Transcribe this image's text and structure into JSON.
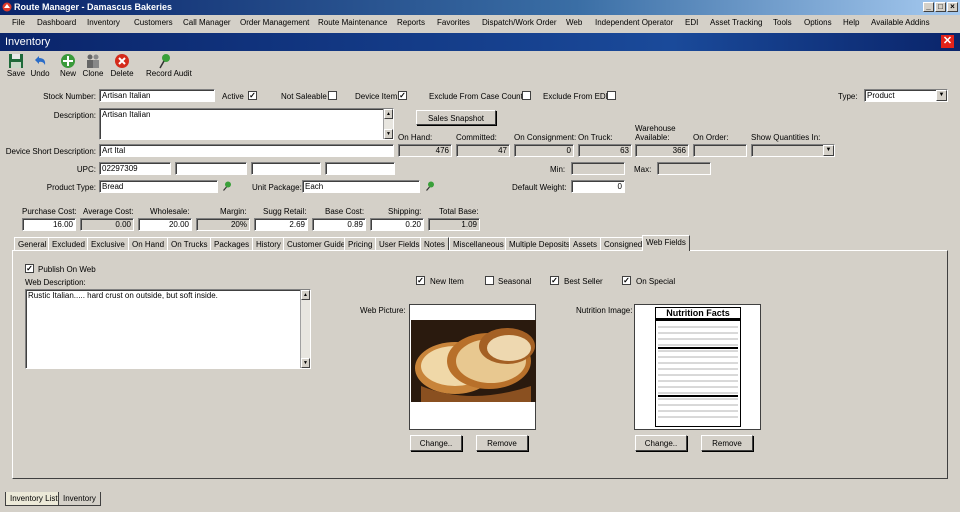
{
  "window": {
    "title": "Route Manager - Damascus Bakeries"
  },
  "menu": [
    "File",
    "Dashboard",
    "Inventory",
    "Customers",
    "Call Manager",
    "Order Management",
    "Route Maintenance",
    "Reports",
    "Favorites",
    "Dispatch/Work Order",
    "Web",
    "Independent Operator",
    "EDI",
    "Asset Tracking",
    "Tools",
    "Options",
    "Help",
    "Available Addins"
  ],
  "form_title": "Inventory",
  "toolbar": {
    "save": "Save",
    "undo": "Undo",
    "new": "New",
    "clone": "Clone",
    "delete": "Delete",
    "record_audit": "Record Audit"
  },
  "fields": {
    "stock_number_label": "Stock Number:",
    "stock_number": "Artisan Italian",
    "active_label": "Active",
    "not_saleable_label": "Not Saleable",
    "device_item_label": "Device Item",
    "exclude_case_counts_label": "Exclude From Case Counts",
    "exclude_edi_label": "Exclude From EDI",
    "type_label": "Type:",
    "type_value": "Product",
    "description_label": "Description:",
    "description": "Artisan Italian",
    "sales_snapshot": "Sales Snapshot",
    "device_short_desc_label": "Device Short Description:",
    "device_short_desc": "Art Ital",
    "upc_label": "UPC:",
    "upc": "02297309",
    "product_type_label": "Product Type:",
    "product_type": "Bread",
    "unit_package_label": "Unit Package:",
    "unit_package": "Each",
    "on_hand_label": "On Hand:",
    "on_hand": "476",
    "committed_label": "Committed:",
    "committed": "47",
    "on_consignment_label": "On Consignment:",
    "on_consignment": "0",
    "on_truck_label": "On Truck:",
    "on_truck": "63",
    "warehouse_available_label": "Warehouse Available:",
    "warehouse_available": "366",
    "on_order_label": "On Order:",
    "show_quantities_label": "Show Quantities In:",
    "min_label": "Min:",
    "max_label": "Max:",
    "default_weight_label": "Default Weight:",
    "default_weight": "0"
  },
  "costs": {
    "purchase_cost_label": "Purchase Cost:",
    "purchase_cost": "16.00",
    "average_cost_label": "Average Cost:",
    "average_cost": "0.00",
    "wholesale_label": "Wholesale:",
    "wholesale": "20.00",
    "margin_label": "Margin:",
    "margin": "20%",
    "sugg_retail_label": "Sugg Retail:",
    "sugg_retail": "2.69",
    "base_cost_label": "Base Cost:",
    "base_cost": "0.89",
    "shipping_label": "Shipping:",
    "shipping": "0.20",
    "total_base_label": "Total Base:",
    "total_base": "1.09"
  },
  "tabs": [
    "General",
    "Excluded",
    "Exclusive",
    "On Hand",
    "On Trucks",
    "Packages",
    "History",
    "Customer Guide",
    "Pricing",
    "User Fields",
    "Notes",
    "Miscellaneous",
    "Multiple Deposits",
    "Assets",
    "Consigned",
    "Web Fields"
  ],
  "web": {
    "publish_label": "Publish On Web",
    "web_description_label": "Web Description:",
    "web_description": "Rustic Italian..... hard crust on outside, but soft inside.",
    "new_item_label": "New Item",
    "seasonal_label": "Seasonal",
    "best_seller_label": "Best Seller",
    "on_special_label": "On Special",
    "web_picture_label": "Web Picture:",
    "nutrition_image_label": "Nutrition Image:",
    "nutrition_title": "Nutrition Facts",
    "change": "Change..",
    "remove": "Remove"
  },
  "bottom_tabs": [
    "Inventory List",
    "Inventory"
  ]
}
